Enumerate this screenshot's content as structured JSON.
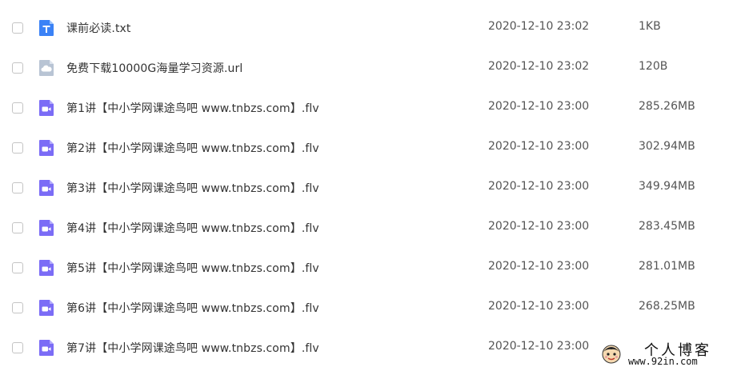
{
  "files": [
    {
      "icon": "text-file-icon",
      "name": "课前必读.txt",
      "date": "2020-12-10 23:02",
      "size": "1KB"
    },
    {
      "icon": "link-file-icon",
      "name": "免费下载10000G海量学习资源.url",
      "date": "2020-12-10 23:02",
      "size": "120B"
    },
    {
      "icon": "video-file-icon",
      "name": "第1讲【中小学网课途鸟吧 www.tnbzs.com】.flv",
      "date": "2020-12-10 23:00",
      "size": "285.26MB"
    },
    {
      "icon": "video-file-icon",
      "name": "第2讲【中小学网课途鸟吧 www.tnbzs.com】.flv",
      "date": "2020-12-10 23:00",
      "size": "302.94MB"
    },
    {
      "icon": "video-file-icon",
      "name": "第3讲【中小学网课途鸟吧 www.tnbzs.com】.flv",
      "date": "2020-12-10 23:00",
      "size": "349.94MB"
    },
    {
      "icon": "video-file-icon",
      "name": "第4讲【中小学网课途鸟吧 www.tnbzs.com】.flv",
      "date": "2020-12-10 23:00",
      "size": "283.45MB"
    },
    {
      "icon": "video-file-icon",
      "name": "第5讲【中小学网课途鸟吧 www.tnbzs.com】.flv",
      "date": "2020-12-10 23:00",
      "size": "281.01MB"
    },
    {
      "icon": "video-file-icon",
      "name": "第6讲【中小学网课途鸟吧 www.tnbzs.com】.flv",
      "date": "2020-12-10 23:00",
      "size": "268.25MB"
    },
    {
      "icon": "video-file-icon",
      "name": "第7讲【中小学网课途鸟吧 www.tnbzs.com】.flv",
      "date": "2020-12-10 23:00",
      "size": ""
    }
  ],
  "watermark": {
    "title": "个人博客",
    "url": "www.92in.com"
  },
  "colors": {
    "text_icon": "#3b82f6",
    "link_icon": "#b8c4d4",
    "video_icon": "#7b6cf6"
  }
}
